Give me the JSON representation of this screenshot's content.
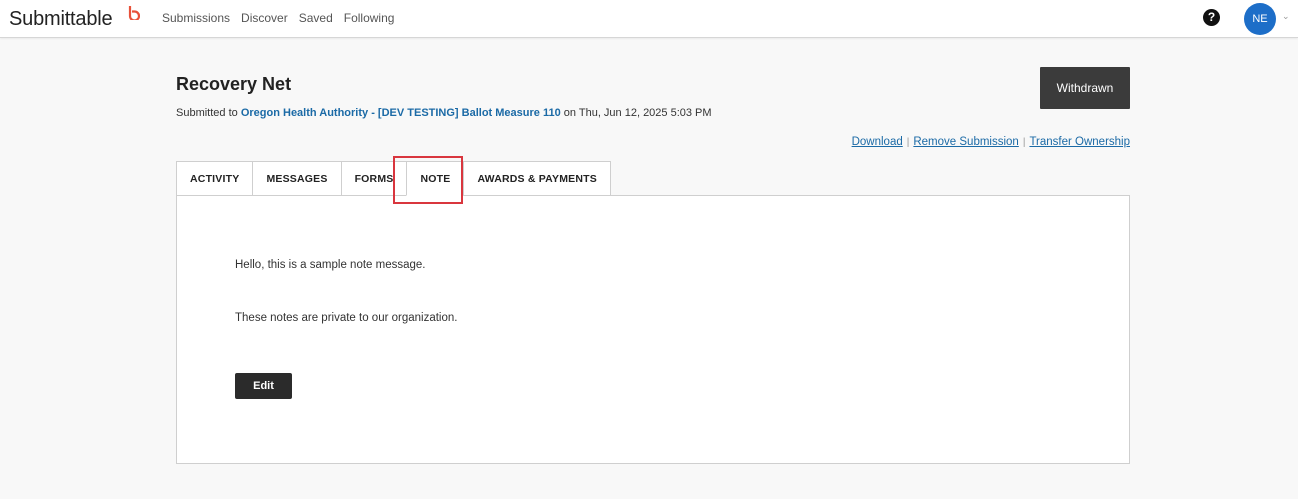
{
  "app": {
    "logo_text": "Submittable",
    "brand_color": "#e8513a",
    "nav": [
      "Submissions",
      "Discover",
      "Saved",
      "Following"
    ],
    "help_icon": "question-circle-icon",
    "avatar_initials": "NE",
    "avatar_color": "#1d6ec8"
  },
  "submission": {
    "title": "Recovery Net",
    "submitted_prefix": "Submitted to",
    "organization": "Oregon Health Authority - [DEV TESTING] Ballot Measure 110",
    "submitted_suffix": "on Thu, Jun 12, 2025 5:03 PM",
    "status_button": "Withdrawn"
  },
  "actions": {
    "download": "Download",
    "remove": "Remove Submission",
    "transfer": "Transfer Ownership"
  },
  "tabs": [
    {
      "label": "ACTIVITY"
    },
    {
      "label": "MESSAGES"
    },
    {
      "label": "FORMS"
    },
    {
      "label": "NOTE"
    },
    {
      "label": "AWARDS & PAYMENTS"
    }
  ],
  "active_tab": "NOTE",
  "highlight_color": "#d9363e",
  "note": {
    "line1": "Hello, this is a sample note message.",
    "line2": "These notes are private to our organization.",
    "edit_label": "Edit"
  }
}
